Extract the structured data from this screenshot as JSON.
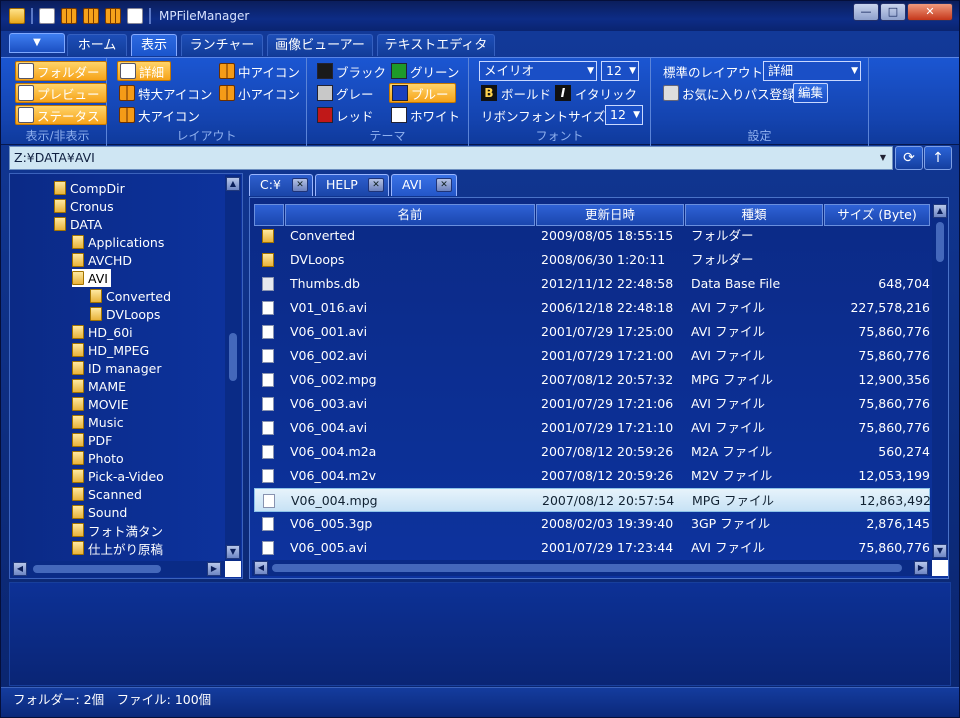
{
  "window": {
    "title": "MPFileManager",
    "min_label": "—",
    "max_label": "□",
    "close_label": "✕"
  },
  "ribbon_tabs": [
    "ホーム",
    "表示",
    "ランチャー",
    "画像ビューアー",
    "テキストエディタ"
  ],
  "app_menu_arrow": "▼",
  "groups": {
    "visibility": {
      "label": "表示/非表示",
      "items": [
        "フォルダー",
        "プレビュー",
        "ステータス"
      ]
    },
    "layout": {
      "label": "レイアウト",
      "items": [
        "詳細",
        "特大アイコン",
        "大アイコン",
        "中アイコン",
        "小アイコン"
      ]
    },
    "theme": {
      "label": "テーマ",
      "items": [
        "ブラック",
        "グレー",
        "レッド",
        "グリーン",
        "ブルー",
        "ホワイト"
      ]
    },
    "font": {
      "label": "フォント",
      "font_name": "メイリオ",
      "font_size": "12",
      "bold": "ボールド",
      "italic": "イタリック",
      "ribbon_font_size_label": "リボンフォントサイズ",
      "ribbon_font_size": "12"
    },
    "settings": {
      "label": "設定",
      "default_layout_label": "標準のレイアウト",
      "default_layout_value": "詳細",
      "favorites_label": "お気に入りパス登録",
      "edit_button": "編集"
    }
  },
  "theme_colors": {
    "black": "#1a1a1a",
    "gray": "#c8c8c8",
    "red": "#c01818",
    "green": "#1e9a2a",
    "blue": "#1a3fbf",
    "white": "#ffffff"
  },
  "address": {
    "path": "Z:¥DATA¥AVI"
  },
  "icons": {
    "refresh": "refresh-icon",
    "up": "up-arrow-icon"
  },
  "tree": [
    {
      "label": "CompDir",
      "level": 2
    },
    {
      "label": "Cronus",
      "level": 2
    },
    {
      "label": "DATA",
      "level": 2
    },
    {
      "label": "Applications",
      "level": 3
    },
    {
      "label": "AVCHD",
      "level": 3
    },
    {
      "label": "AVI",
      "level": 3,
      "selected": true
    },
    {
      "label": "Converted",
      "level": 4
    },
    {
      "label": "DVLoops",
      "level": 4
    },
    {
      "label": "HD_60i",
      "level": 3
    },
    {
      "label": "HD_MPEG",
      "level": 3
    },
    {
      "label": "ID manager",
      "level": 3
    },
    {
      "label": "MAME",
      "level": 3
    },
    {
      "label": "MOVIE",
      "level": 3
    },
    {
      "label": "Music",
      "level": 3
    },
    {
      "label": "PDF",
      "level": 3
    },
    {
      "label": "Photo",
      "level": 3
    },
    {
      "label": "Pick-a-Video",
      "level": 3
    },
    {
      "label": "Scanned",
      "level": 3
    },
    {
      "label": "Sound",
      "level": 3
    },
    {
      "label": "フォト満タン",
      "level": 3
    },
    {
      "label": "仕上がり原稿",
      "level": 3
    }
  ],
  "doc_tabs": [
    "C:¥",
    "HELP",
    "AVI"
  ],
  "columns": [
    "名前",
    "更新日時",
    "種類",
    "サイズ (Byte)"
  ],
  "files": [
    {
      "name": "Converted",
      "date": "2009/08/05 18:55:15",
      "type": "フォルダー",
      "size": "",
      "icon": "folder"
    },
    {
      "name": "DVLoops",
      "date": "2008/06/30 1:20:11",
      "type": "フォルダー",
      "size": "",
      "icon": "folder"
    },
    {
      "name": "Thumbs.db",
      "date": "2012/11/12 22:48:58",
      "type": "Data Base File",
      "size": "648,704",
      "icon": "db"
    },
    {
      "name": "V01_016.avi",
      "date": "2006/12/18 22:48:18",
      "type": "AVI ファイル",
      "size": "227,578,216",
      "icon": "file"
    },
    {
      "name": "V06_001.avi",
      "date": "2001/07/29 17:25:00",
      "type": "AVI ファイル",
      "size": "75,860,776",
      "icon": "file"
    },
    {
      "name": "V06_002.avi",
      "date": "2001/07/29 17:21:00",
      "type": "AVI ファイル",
      "size": "75,860,776",
      "icon": "file"
    },
    {
      "name": "V06_002.mpg",
      "date": "2007/08/12 20:57:32",
      "type": "MPG ファイル",
      "size": "12,900,356",
      "icon": "file"
    },
    {
      "name": "V06_003.avi",
      "date": "2001/07/29 17:21:06",
      "type": "AVI ファイル",
      "size": "75,860,776",
      "icon": "file"
    },
    {
      "name": "V06_004.avi",
      "date": "2001/07/29 17:21:10",
      "type": "AVI ファイル",
      "size": "75,860,776",
      "icon": "file"
    },
    {
      "name": "V06_004.m2a",
      "date": "2007/08/12 20:59:26",
      "type": "M2A ファイル",
      "size": "560,274",
      "icon": "file"
    },
    {
      "name": "V06_004.m2v",
      "date": "2007/08/12 20:59:26",
      "type": "M2V ファイル",
      "size": "12,053,199",
      "icon": "file"
    },
    {
      "name": "V06_004.mpg",
      "date": "2007/08/12 20:57:54",
      "type": "MPG ファイル",
      "size": "12,863,492",
      "icon": "file",
      "selected": true
    },
    {
      "name": "V06_005.3gp",
      "date": "2008/02/03 19:39:40",
      "type": "3GP ファイル",
      "size": "2,876,145",
      "icon": "file"
    },
    {
      "name": "V06_005.avi",
      "date": "2001/07/29 17:23:44",
      "type": "AVI ファイル",
      "size": "75,860,776",
      "icon": "file"
    }
  ],
  "status": {
    "text": "フォルダー: 2個　ファイル: 100個"
  }
}
